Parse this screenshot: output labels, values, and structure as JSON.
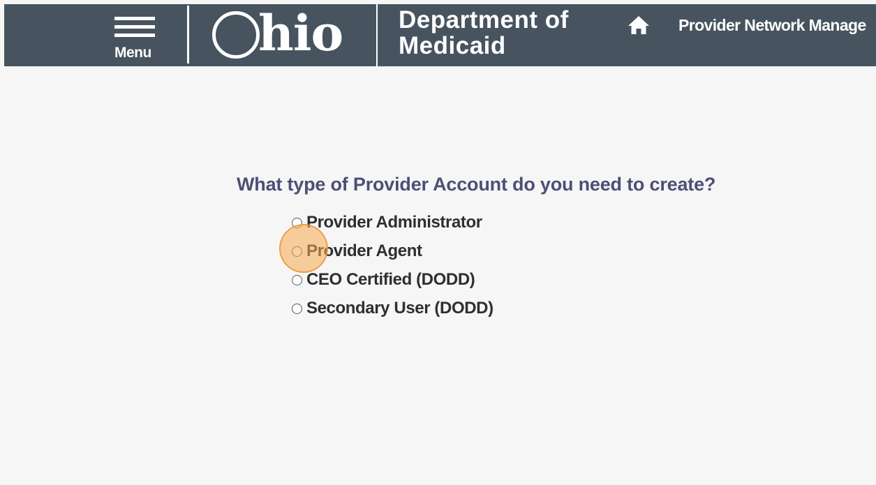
{
  "header": {
    "menu_label": "Menu",
    "logo_text": "hio",
    "logo_alt": "Ohio",
    "department_line1": "Department of",
    "department_line2": "Medicaid",
    "nav_link": "Provider Network Manage",
    "background_color": "#47545f"
  },
  "main": {
    "question": "What type of Provider Account do you need to create?",
    "question_color": "#4d4f76",
    "options": [
      {
        "label": "Provider Administrator",
        "selected": false
      },
      {
        "label": "Provider Agent",
        "selected": false
      },
      {
        "label": "CEO Certified (DODD)",
        "selected": false
      },
      {
        "label": "Secondary User (DODD)",
        "selected": false
      }
    ]
  },
  "icons": {
    "menu": "hamburger-menu-icon",
    "home": "home-icon",
    "radio": "radio-button-icon"
  },
  "highlight": {
    "target": "Provider Agent",
    "color": "#f5aa50"
  }
}
